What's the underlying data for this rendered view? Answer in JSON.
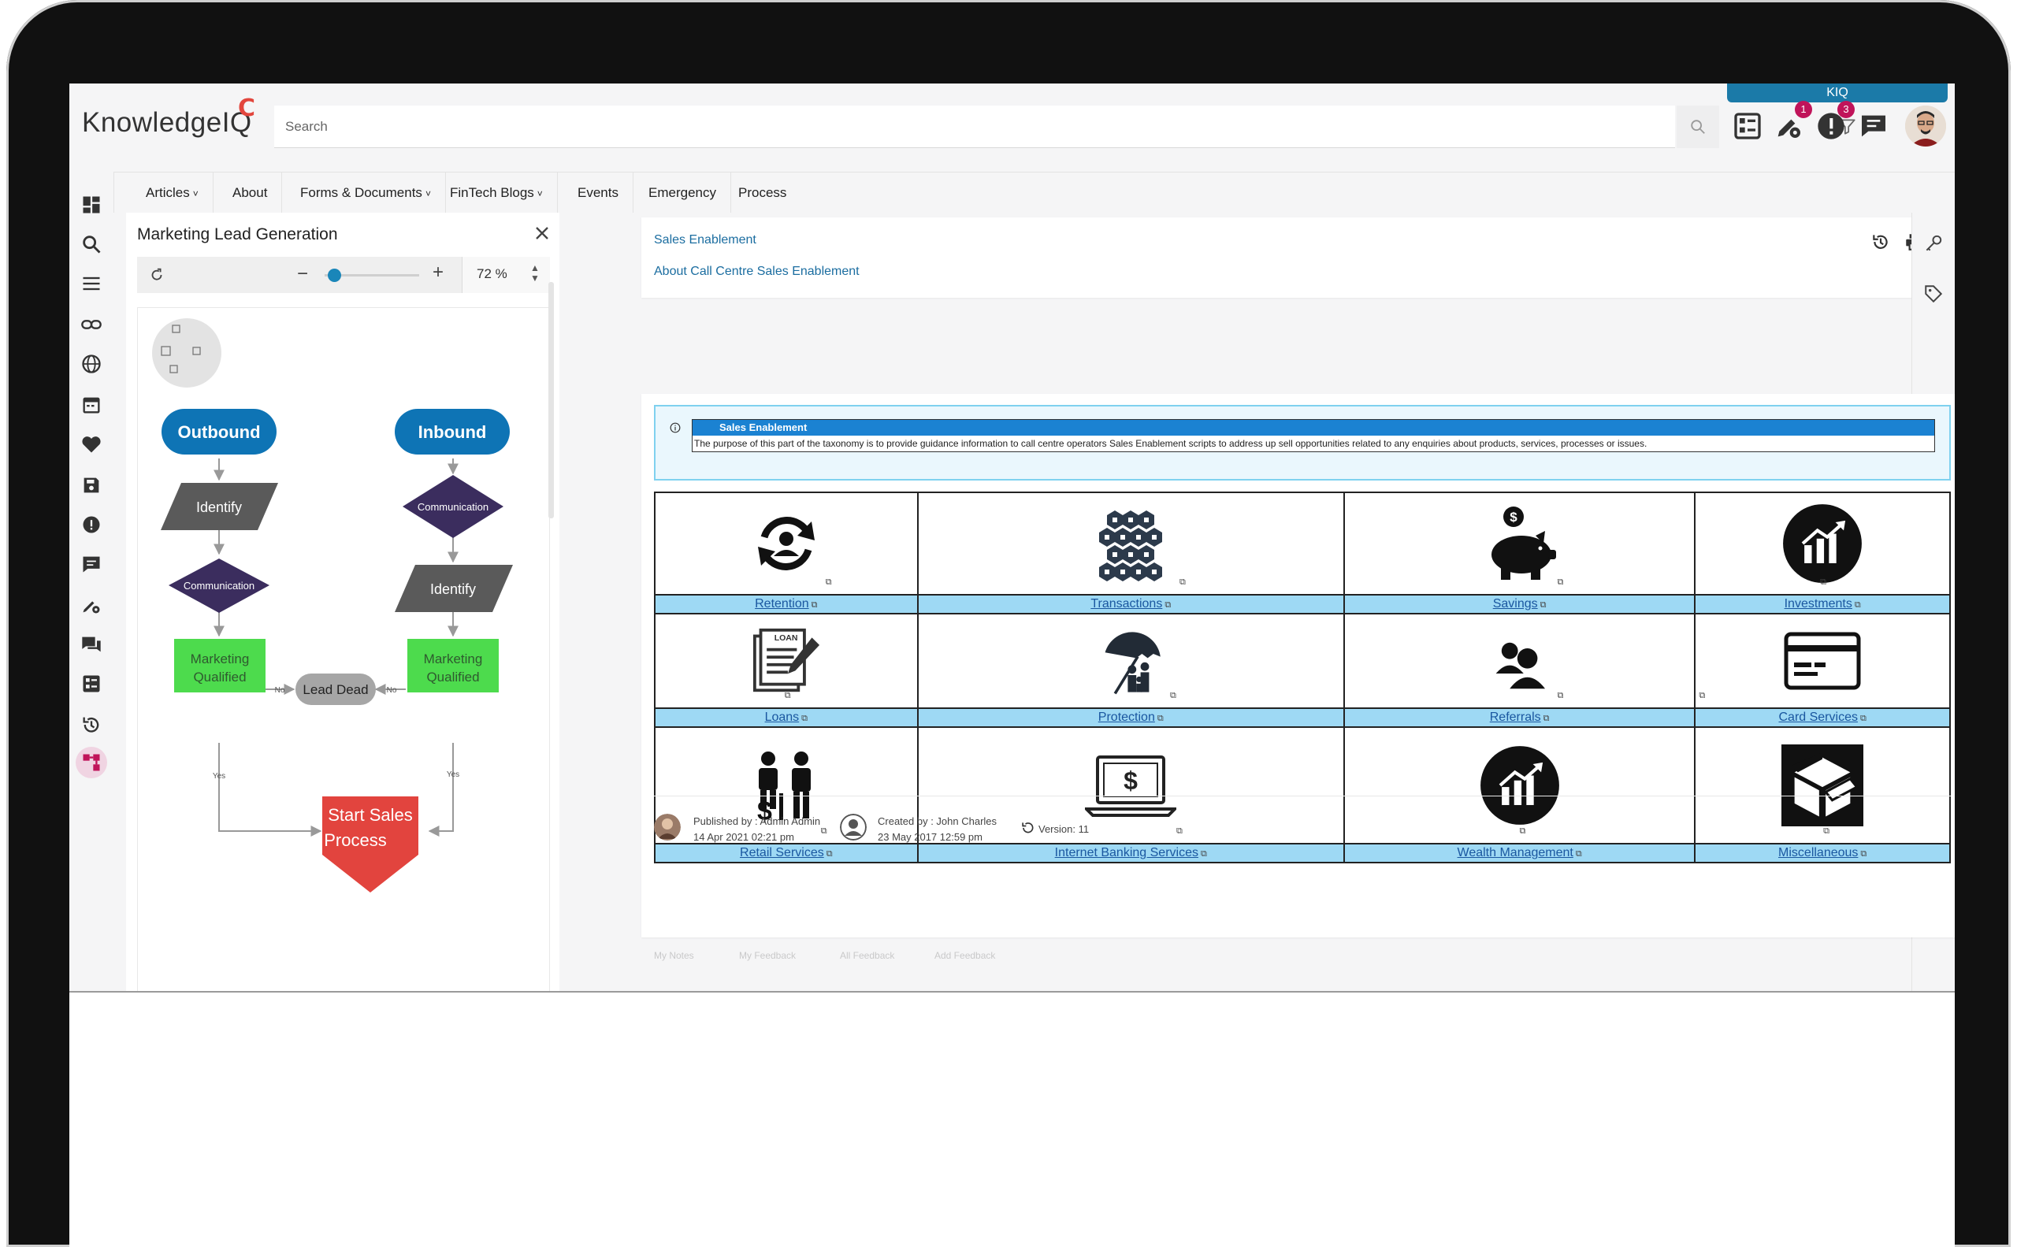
{
  "header": {
    "logo": "KnowledgeIQ",
    "search_placeholder": "Search",
    "kiq_tab": "KIQ",
    "settings_badge": "1",
    "alerts_badge": "3"
  },
  "nav": {
    "items": [
      {
        "label": "Articles",
        "dropdown": true
      },
      {
        "label": "About",
        "dropdown": false
      },
      {
        "label": "Forms & Documents",
        "dropdown": true
      },
      {
        "label": "FinTech Blogs",
        "dropdown": true
      },
      {
        "label": "Events",
        "dropdown": false
      },
      {
        "label": "Emergency",
        "dropdown": false
      },
      {
        "label": "Process",
        "dropdown": false
      }
    ]
  },
  "flow_panel": {
    "title": "Marketing Lead Generation",
    "zoom_value": "72",
    "zoom_unit": "%",
    "zoom_level": 0.1,
    "nodes": {
      "outbound": "Outbound",
      "inbound": "Inbound",
      "identify_left": "Identify",
      "communication_right": "Communication",
      "communication_left": "Communication",
      "identify_right": "Identify",
      "mq_left_1": "Marketing",
      "mq_left_2": "Qualified",
      "lead_dead": "Lead Dead",
      "mq_right_1": "Marketing",
      "mq_right_2": "Qualified",
      "start_1": "Start Sales",
      "start_2": "Process",
      "no_left": "No",
      "no_right": "No",
      "yes_left": "Yes",
      "yes_right": "Yes"
    }
  },
  "breadcrumb": {
    "parent": "Sales Enablement",
    "current": "About Call Centre Sales Enablement"
  },
  "article": {
    "intro_heading": "Sales Enablement",
    "intro_text": "The purpose of this part of the taxonomy is to provide guidance information to call centre operators Sales Enablement scripts to address up sell opportunities related to any enquiries about products, services,  processes or issues.",
    "tiles": [
      {
        "label": "Retention",
        "icon": "retention-icon"
      },
      {
        "label": "Transactions",
        "icon": "transactions-icon"
      },
      {
        "label": "Savings",
        "icon": "piggy-bank-icon"
      },
      {
        "label": "Investments",
        "icon": "investment-chart-icon"
      },
      {
        "label": "Loans",
        "icon": "loan-document-icon"
      },
      {
        "label": "Protection",
        "icon": "umbrella-family-icon"
      },
      {
        "label": "Referrals",
        "icon": "referral-people-icon"
      },
      {
        "label": "Card Services",
        "icon": "credit-card-icon"
      },
      {
        "label": "Retail Services",
        "icon": "retail-people-icon"
      },
      {
        "label": "Internet Banking Services",
        "icon": "laptop-dollar-icon"
      },
      {
        "label": "Wealth Management",
        "icon": "wealth-chart-icon"
      },
      {
        "label": "Miscellaneous",
        "icon": "open-box-icon"
      }
    ],
    "published_by": "Published by : Admin Admin",
    "published_date": "14 Apr 2021 02:21 pm",
    "created_by": "Created by : John Charles",
    "created_date": "23 May 2017 12:59 pm",
    "version": "Version: 11"
  },
  "footer_tools": [
    "My Notes",
    "My Feedback",
    "All Feedback",
    "Add Feedback"
  ],
  "colors": {
    "accent": "#1b7aa8",
    "badge": "#c0145a",
    "outbound_node": "#0e74b5",
    "decision_node": "#3b2d5e",
    "process_node": "#5a5a5a",
    "qualified_node": "#4ddb4d",
    "start_node": "#e2443e",
    "tile_label_bg": "#9ed9f4"
  }
}
